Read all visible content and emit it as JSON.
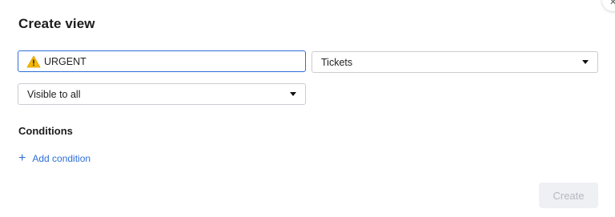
{
  "dialog": {
    "title": "Create view"
  },
  "form": {
    "name": {
      "value": "URGENT",
      "icon": "warning-icon"
    },
    "entity": {
      "selected": "Tickets"
    },
    "visibility": {
      "selected": "Visible to all"
    }
  },
  "conditions": {
    "heading": "Conditions",
    "add_label": "Add condition",
    "add_icon_glyph": "+"
  },
  "footer": {
    "create_label": "Create"
  },
  "colors": {
    "accent": "#2e6fd8",
    "warning": "#f5b800",
    "disabled_bg": "#eef0f3",
    "disabled_text": "#b4b9c1"
  }
}
